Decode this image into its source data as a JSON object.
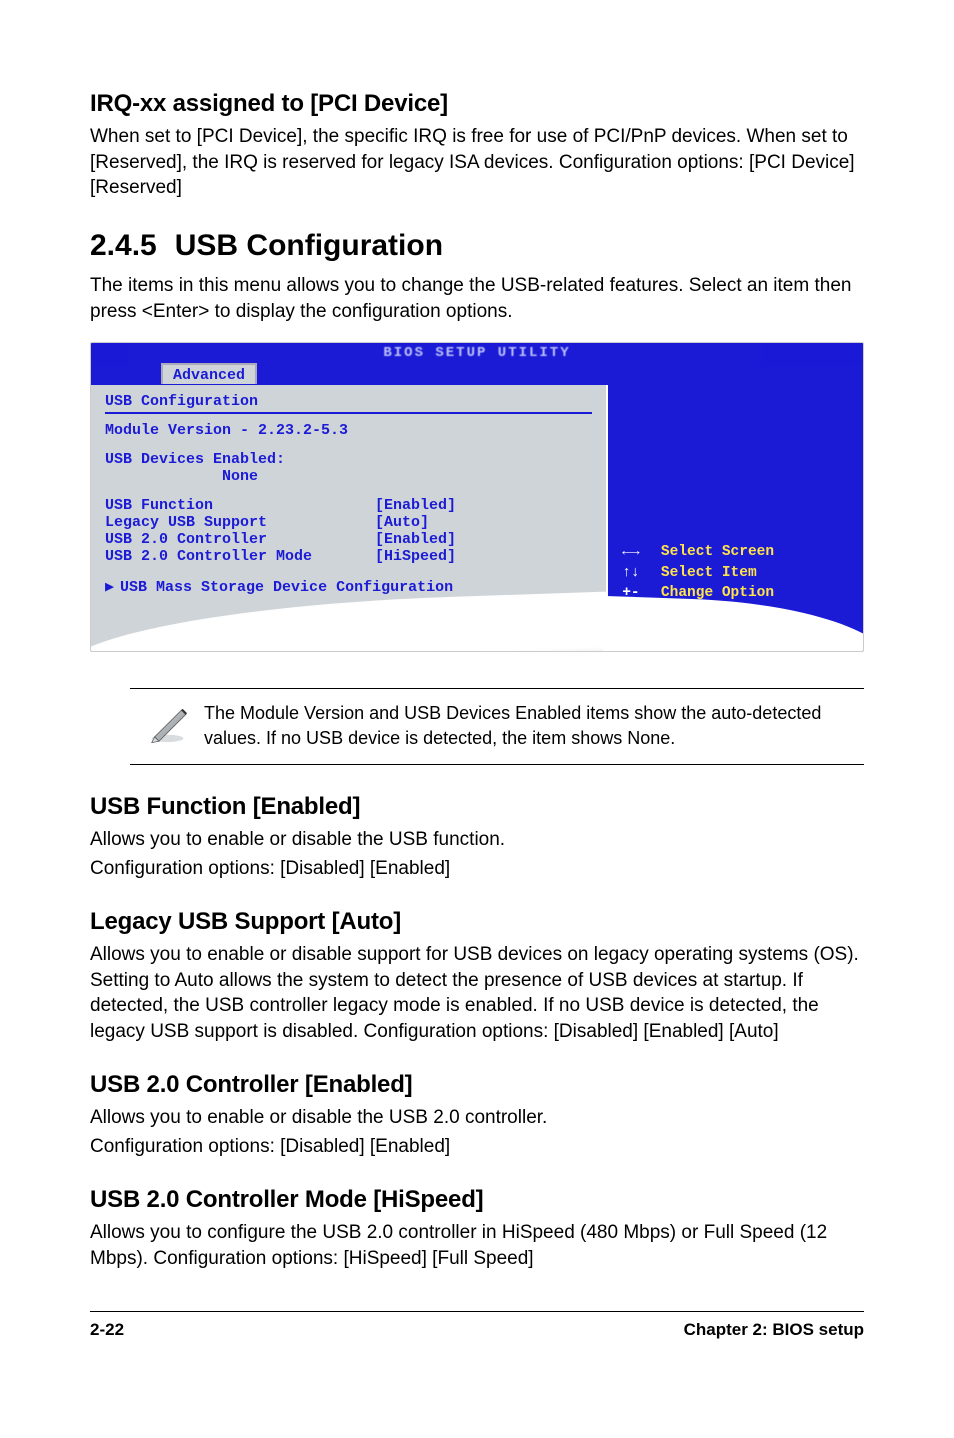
{
  "intro": {
    "heading": "IRQ-xx assigned to [PCI Device]",
    "body": "When set to [PCI Device], the specific IRQ is free for use of PCI/PnP devices. When set to [Reserved], the IRQ is reserved for legacy ISA devices. Configuration options: [PCI Device] [Reserved]"
  },
  "section": {
    "number": "2.4.5",
    "title": "USB Configuration",
    "lead": "The items in this menu allows you to change the USB-related features. Select an item then press <Enter> to display the configuration options."
  },
  "bios": {
    "utility_title": "BIOS SETUP UTILITY",
    "tab": "Advanced",
    "pane_title": "USB Configuration",
    "module_version_label": "Module Version - 2.23.2-5.3",
    "devices_label": "USB Devices Enabled:",
    "devices_value": "None",
    "settings": [
      {
        "label": "USB Function",
        "value": "[Enabled]"
      },
      {
        "label": "Legacy USB Support",
        "value": "[Auto]"
      },
      {
        "label": "USB 2.0 Controller",
        "value": "[Enabled]"
      },
      {
        "label": "USB 2.0 Controller Mode",
        "value": "[HiSpeed]"
      }
    ],
    "submenu": "USB Mass Storage Device Configuration",
    "keys": [
      {
        "sym": "←→",
        "label": "Select Screen"
      },
      {
        "sym": "↑↓",
        "label": "Select Item"
      },
      {
        "sym": "+-",
        "label": "Change Option"
      }
    ]
  },
  "note": {
    "text": "The Module Version and USB Devices Enabled items show the auto-detected values. If no USB device is detected, the item shows None."
  },
  "subsections": [
    {
      "heading": "USB Function [Enabled]",
      "paras": [
        "Allows you to enable or disable the USB function.",
        "Configuration options: [Disabled] [Enabled]"
      ]
    },
    {
      "heading": "Legacy USB Support [Auto]",
      "paras": [
        "Allows you to enable or disable support for USB devices on legacy operating systems (OS). Setting to Auto allows the system to detect the presence of USB devices at startup. If detected, the USB controller legacy mode is enabled. If no USB device is detected, the legacy USB support is disabled. Configuration options: [Disabled] [Enabled] [Auto]"
      ]
    },
    {
      "heading": "USB 2.0 Controller [Enabled]",
      "paras": [
        "Allows you to enable or disable the USB 2.0 controller.",
        "Configuration options: [Disabled] [Enabled]"
      ]
    },
    {
      "heading": "USB 2.0 Controller Mode [HiSpeed]",
      "paras": [
        "Allows you to configure the USB 2.0 controller in HiSpeed (480 Mbps) or Full Speed (12 Mbps). Configuration options: [HiSpeed] [Full Speed]"
      ]
    }
  ],
  "footer": {
    "left": "2-22",
    "right": "Chapter 2: BIOS setup"
  }
}
